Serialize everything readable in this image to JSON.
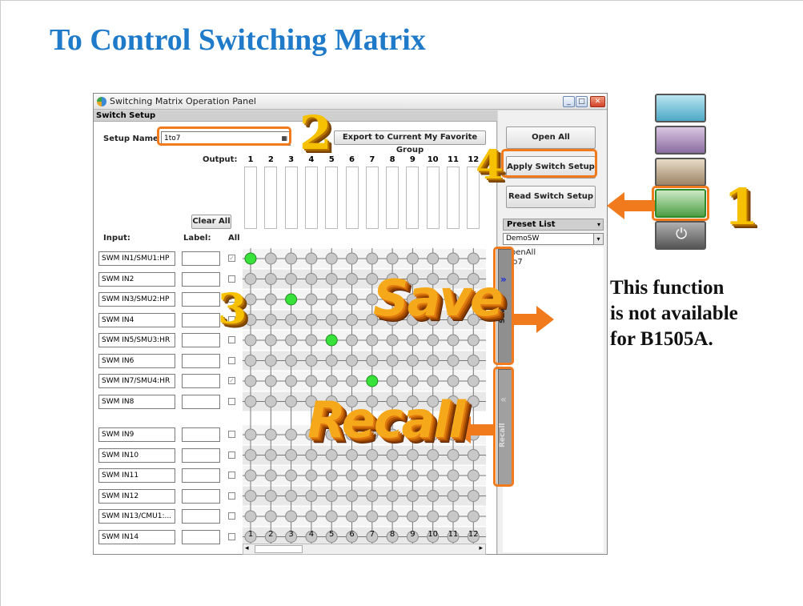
{
  "slide": {
    "title": "To Control Switching Matrix",
    "note_lines": [
      "This function",
      "is not available",
      "for B1505A."
    ]
  },
  "window": {
    "title": "Switching Matrix Operation Panel",
    "section": "Switch Setup",
    "setup_name_label": "Setup Name :",
    "setup_name_value": "1to7",
    "export_button": "Export to Current My Favorite Group",
    "output_label": "Output:",
    "clear_all_button": "Clear All",
    "input_label": "Input:",
    "label_label": "Label:",
    "all_label": "All",
    "outputs": [
      "1",
      "2",
      "3",
      "4",
      "5",
      "6",
      "7",
      "8",
      "9",
      "10",
      "11",
      "12"
    ],
    "inputs": [
      {
        "name": "SWM IN1/SMU1:HP",
        "all_checked": true,
        "connected_output": 1
      },
      {
        "name": "SWM IN2",
        "all_checked": false,
        "connected_output": null
      },
      {
        "name": "SWM IN3/SMU2:HP",
        "all_checked": true,
        "connected_output": 3
      },
      {
        "name": "SWM IN4",
        "all_checked": false,
        "connected_output": null
      },
      {
        "name": "SWM IN5/SMU3:HR",
        "all_checked": false,
        "connected_output": 5
      },
      {
        "name": "SWM IN6",
        "all_checked": false,
        "connected_output": null
      },
      {
        "name": "SWM IN7/SMU4:HR",
        "all_checked": true,
        "connected_output": 7
      },
      {
        "name": "SWM IN8",
        "all_checked": false,
        "connected_output": null
      },
      {
        "name": "SWM IN9",
        "all_checked": false,
        "connected_output": null
      },
      {
        "name": "SWM IN10",
        "all_checked": false,
        "connected_output": null
      },
      {
        "name": "SWM IN11",
        "all_checked": false,
        "connected_output": null
      },
      {
        "name": "SWM IN12",
        "all_checked": false,
        "connected_output": null
      },
      {
        "name": "SWM IN13/CMU1:...",
        "all_checked": false,
        "connected_output": null
      },
      {
        "name": "SWM IN14",
        "all_checked": false,
        "connected_output": null
      }
    ],
    "buttons": {
      "open_all": "Open All",
      "apply": "Apply Switch Setup",
      "read": "Read Switch Setup"
    },
    "preset": {
      "header": "Preset List",
      "selected": "DemoSW",
      "items": [
        "OpenAll",
        "1to7"
      ]
    },
    "save_tab": "Save",
    "recall_tab": "Recall"
  },
  "callouts": {
    "one": "1",
    "two": "2",
    "three": "3",
    "four": "4",
    "save": "Save",
    "recall": "Recall"
  },
  "colors": {
    "title": "#1f7ac9",
    "highlight": "#f07a1c",
    "node_on": "#39e23a",
    "node_off": "#c8c8c8"
  }
}
